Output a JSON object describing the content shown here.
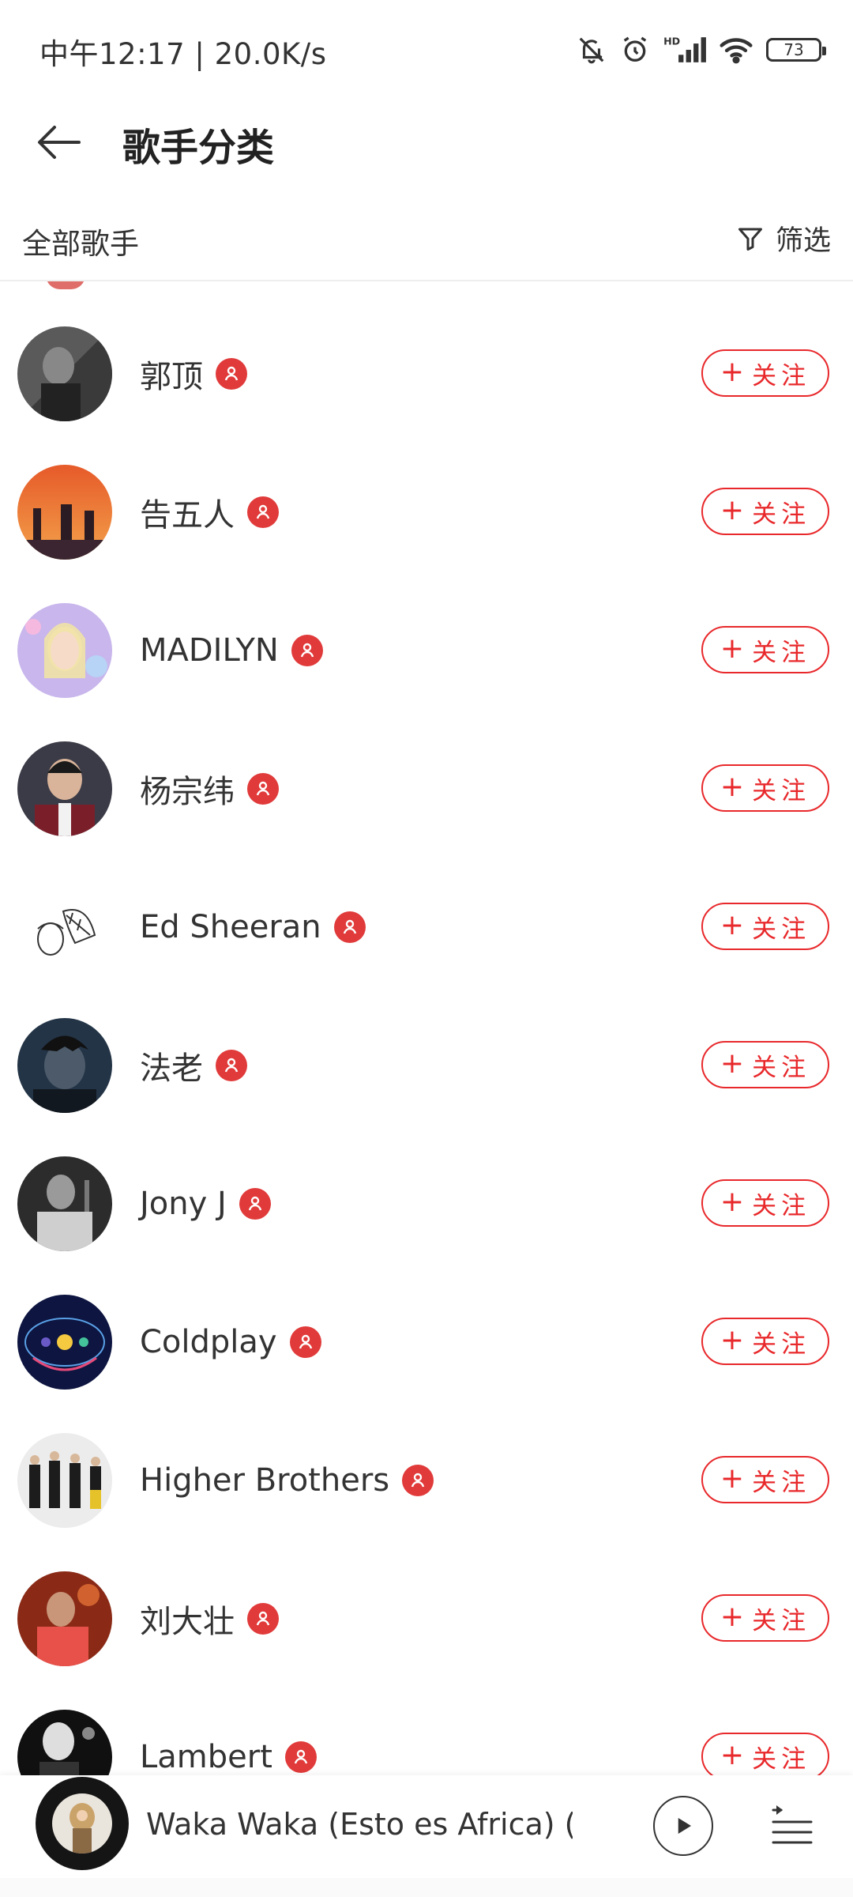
{
  "status": {
    "time_speed": "中午12:17 | 20.0K/s",
    "battery": "73",
    "icons": [
      "mute-icon",
      "alarm-icon",
      "hd-signal-icon",
      "wifi-icon",
      "battery-icon"
    ]
  },
  "header": {
    "title": "歌手分类",
    "back_icon": "arrow-left-icon"
  },
  "filter": {
    "left_label": "全部歌手",
    "right_label": "筛选",
    "icon": "funnel-icon"
  },
  "follow": {
    "plus": "+",
    "label": "关注"
  },
  "artists": [
    {
      "name": "郭顶",
      "avatar_style": "dark-gray"
    },
    {
      "name": "告五人",
      "avatar_style": "sunset"
    },
    {
      "name": "MADILYN",
      "avatar_style": "pastel"
    },
    {
      "name": "杨宗纬",
      "avatar_style": "portrait"
    },
    {
      "name": "Ed Sheeran",
      "avatar_style": "sketch"
    },
    {
      "name": "法老",
      "avatar_style": "blue-dark"
    },
    {
      "name": "Jony J",
      "avatar_style": "bw"
    },
    {
      "name": "Coldplay",
      "avatar_style": "cosmic"
    },
    {
      "name": "Higher Brothers",
      "avatar_style": "group"
    },
    {
      "name": "刘大壮",
      "avatar_style": "red-stage"
    },
    {
      "name": "Lambert",
      "avatar_style": "black"
    }
  ],
  "player": {
    "title": "Waka Waka (Esto es Africa) (…"
  },
  "colors": {
    "accent": "#e8282b",
    "badge": "#e13a3a",
    "text": "#333333"
  }
}
